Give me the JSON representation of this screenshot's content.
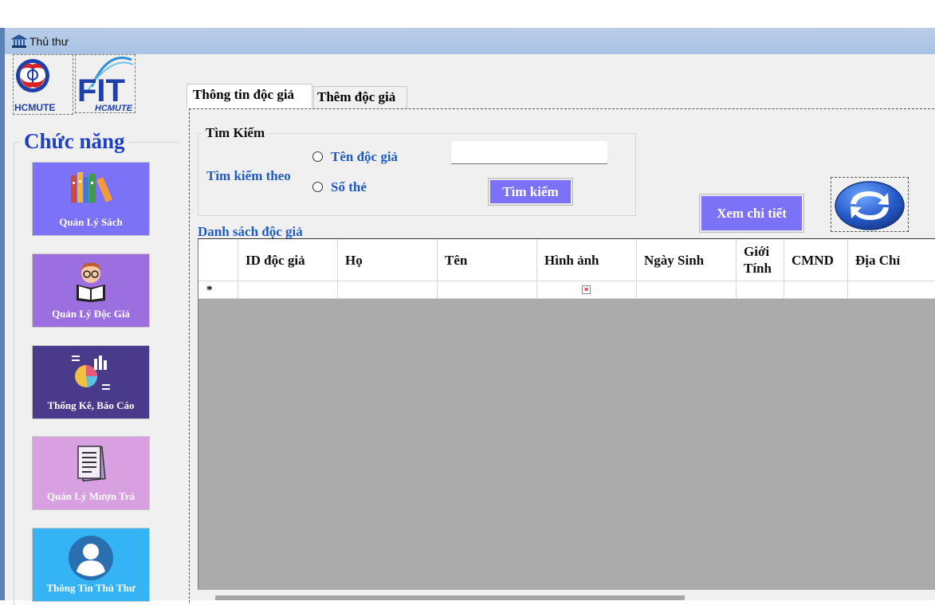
{
  "window": {
    "title": "Thủ thư"
  },
  "logos": {
    "hcmute_text": "HCMUTE",
    "fit_text": "FIT",
    "fit_sub": "HCMUTE"
  },
  "sidebar": {
    "title": "Chức năng",
    "items": [
      {
        "label": "Quản Lý Sách",
        "color": "#7b72f8",
        "icon": "books-icon"
      },
      {
        "label": "Quản Lý Độc Giả",
        "color": "#9b6fe0",
        "icon": "reader-icon"
      },
      {
        "label": "Thống Kê, Báo Cáo",
        "color": "#4a3a8c",
        "icon": "report-chart-icon"
      },
      {
        "label": "Quản Lý Mượn Trả",
        "color": "#d8a0e0",
        "icon": "document-icon"
      },
      {
        "label": "Thông Tin Thủ Thư",
        "color": "#34b3f5",
        "icon": "user-icon"
      }
    ]
  },
  "tabs": [
    {
      "label": "Thông tin độc giả",
      "active": true
    },
    {
      "label": "Thêm độc giả",
      "active": false
    }
  ],
  "search": {
    "group_title": "Tìm Kiếm",
    "by_label": "Tìm kiếm theo",
    "options": [
      "Tên độc giả",
      "Số thẻ"
    ],
    "input_value": "",
    "button_label": "Tìm kiếm"
  },
  "actions": {
    "detail_label": "Xem chi tiết",
    "refresh_icon": "refresh-icon"
  },
  "grid": {
    "title": "Danh sách độc giả",
    "columns": [
      "ID độc giả",
      "Họ",
      "Tên",
      "Hình ảnh",
      "Ngày Sinh",
      "Giới Tính",
      "CMND",
      "Địa Chỉ"
    ],
    "new_row_marker": "*",
    "rows": []
  },
  "colors": {
    "accent": "#7b72f8",
    "label_blue": "#1f5bc6",
    "title_blue": "#1d3fc4",
    "grid_empty": "#ababab"
  }
}
